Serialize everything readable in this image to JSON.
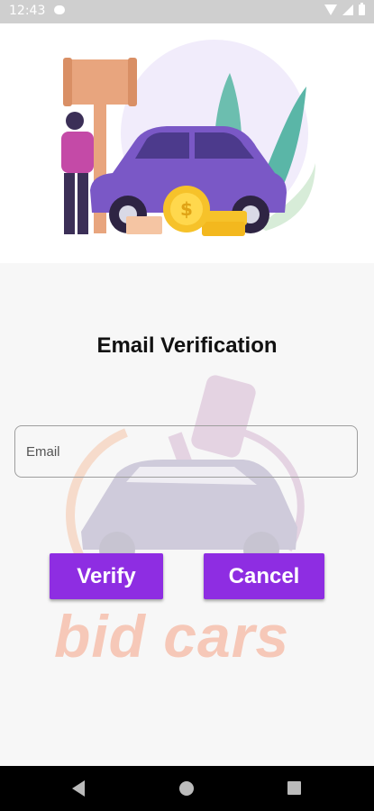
{
  "status_bar": {
    "time": "12:43"
  },
  "screen": {
    "title": "Email Verification"
  },
  "form": {
    "email_placeholder": "Email",
    "email_value": ""
  },
  "buttons": {
    "verify": "Verify",
    "cancel": "Cancel"
  },
  "watermark": {
    "text": "bid cars"
  },
  "colors": {
    "accent": "#8e2de2",
    "car": "#7a58c6",
    "coin": "#f6c22a",
    "gavel": "#e8a57e"
  },
  "icons": {
    "status": [
      "notification-icon",
      "wifi-icon",
      "signal-icon",
      "battery-icon"
    ],
    "nav": [
      "back-icon",
      "home-icon",
      "recent-apps-icon"
    ]
  }
}
